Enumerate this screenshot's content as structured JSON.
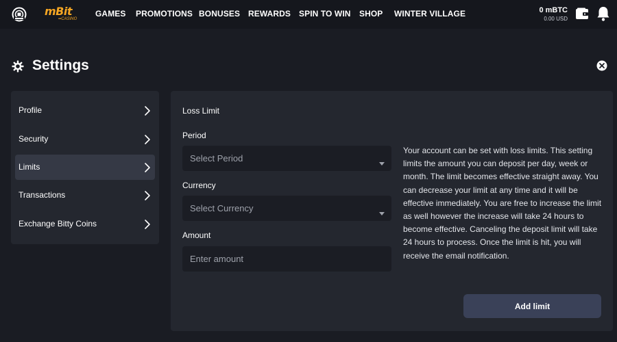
{
  "header": {
    "brand": "mBit",
    "brand_sub": "▪▪CASINO",
    "nav": [
      {
        "label": "GAMES"
      },
      {
        "label": "PROMOTIONS"
      },
      {
        "label": "BONUSES"
      },
      {
        "label": "REWARDS"
      },
      {
        "label": "SPIN TO WIN"
      },
      {
        "label": "SHOP"
      },
      {
        "label": "WINTER VILLAGE"
      }
    ],
    "balance_btc": "0 mBTC",
    "balance_usd": "0.00 USD",
    "accent_color": "#f5a623"
  },
  "page": {
    "title": "Settings"
  },
  "sidebar": {
    "items": [
      {
        "label": "Profile"
      },
      {
        "label": "Security"
      },
      {
        "label": "Limits",
        "active": true
      },
      {
        "label": "Transactions"
      },
      {
        "label": "Exchange Bitty Coins"
      }
    ]
  },
  "form": {
    "section_title": "Loss Limit",
    "period_label": "Period",
    "period_placeholder": "Select Period",
    "currency_label": "Currency",
    "currency_placeholder": "Select Currency",
    "amount_label": "Amount",
    "amount_placeholder": "Enter amount",
    "add_button": "Add limit"
  },
  "info": {
    "text": "Your account can be set with loss limits. This setting limits the amount you can deposit per day, week or month. The limit becomes effective straight away. You can decrease your limit at any time and it will be effective immediately. You are free to increase the limit as well however the increase will take 24 hours to become effective. Canceling the deposit limit will take 24 hours to process. Once the limit is hit, you will receive the email notification."
  },
  "icons": [
    "logo-mark-icon",
    "wallet-icon",
    "bell-icon",
    "gear-icon",
    "close-icon",
    "chevron-right-icon",
    "caret-down-icon"
  ]
}
